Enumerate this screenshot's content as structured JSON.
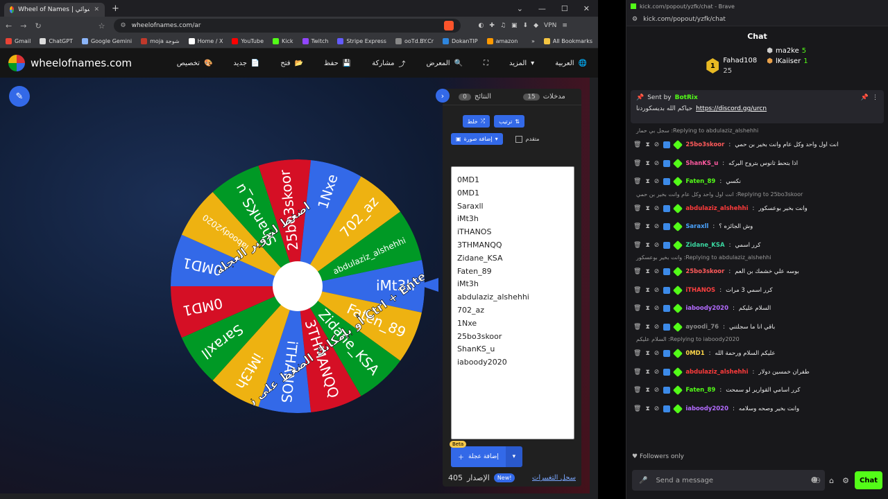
{
  "browser1": {
    "tab_title": "Wheel of Names | عجلة الاختيار العشوائي",
    "url": "wheelofnames.com/ar",
    "vpn": "VPN",
    "bookmarks": [
      {
        "label": "Gmail",
        "color": "#ea4335"
      },
      {
        "label": "ChatGPT",
        "color": "#dddddd"
      },
      {
        "label": "Google Gemini",
        "color": "#8ab4f8"
      },
      {
        "label": "moja شوجة",
        "color": "#c0392b"
      },
      {
        "label": "Home / X",
        "color": "#ffffff"
      },
      {
        "label": "YouTube",
        "color": "#ff0000"
      },
      {
        "label": "Kick",
        "color": "#53fc18"
      },
      {
        "label": "Twitch",
        "color": "#9146ff"
      },
      {
        "label": "Stripe Express",
        "color": "#635bff"
      },
      {
        "label": "ooTd.BY.Cr",
        "color": "#888888"
      },
      {
        "label": "DokanTIP",
        "color": "#2e86de"
      },
      {
        "label": "amazon",
        "color": "#ff9900"
      }
    ],
    "all_bookmarks": "All Bookmarks"
  },
  "site": {
    "logo": "wheelofnames.com",
    "menu": [
      "تخصيص",
      "جديد",
      "فتح",
      "حفظ",
      "مشاركة",
      "المعرض",
      "",
      "المزيد",
      "العربية"
    ]
  },
  "wheel": {
    "segments": [
      "iMt3h",
      "Faten_89",
      "Zidane_KSA",
      "3THMANQQ",
      "iTHANOS",
      "iMt3h",
      "Saraxll",
      "0MD1",
      "0MD1",
      "iaboody2020",
      "ShanKS_u",
      "25bo3skoor",
      "1Nxe",
      "702_az",
      "abdulaziz_alshehhi"
    ],
    "colors": [
      "#3369e8",
      "#eeb211",
      "#009925",
      "#d50f25"
    ],
    "overlay_line1": "اضغط لتدوير العجلة",
    "overlay_line2": "أو بإمكانك الضغط على زر Ctrl + Enter"
  },
  "panel": {
    "tab_entries": "مدخلات",
    "entries_count": "15",
    "tab_results": "النتائج",
    "results_count": "0",
    "shuffle": "خلط",
    "sort": "ترتيب",
    "add_image": "إضافة صورة",
    "advanced": "متقدم",
    "entries": [
      "0MD1",
      "0MD1",
      "Saraxll",
      "iMt3h",
      "iTHANOS",
      "3THMANQQ",
      "Zidane_KSA",
      "Faten_89",
      "iMt3h",
      "abdulaziz_alshehhi",
      "702_az",
      "1Nxe",
      "25bo3skoor",
      "ShanKS_u",
      "iaboody2020"
    ],
    "add_wheel": "إضافة عجلة",
    "beta": "Beta",
    "version_label": "الإصدار",
    "version": "405",
    "new": "New!",
    "changelog": "سجل التغييرات"
  },
  "browser2": {
    "title": "kick.com/popout/yzfk/chat - Brave",
    "url": "kick.com/popout/yzfk/chat"
  },
  "chat": {
    "header": "Chat",
    "leaders": [
      {
        "name": "Fahad108",
        "value": "25",
        "rank": "1"
      },
      {
        "name": "ma2ke",
        "value": "5"
      },
      {
        "name": "lKaiiser",
        "value": "1"
      }
    ],
    "pinned_by": "Sent by",
    "pinned_user": "BotRix",
    "pinned_text": "حياكم الله بديسكوردنا",
    "pinned_link": "https://discord.gg/urcn",
    "messages": [
      {
        "reply": "Replying to abdulaziz_alshehhi: سجل بي حمار",
        "user": "25bo3skoor",
        "color": "#ff5a5a",
        "text": "انت اول واحد وكل عام وانت بخير بن حمي"
      },
      {
        "reply": "",
        "user": "ShanKS_u",
        "color": "#ff5aa0",
        "text": "اذا بتحط ثانوس بتروح البركه"
      },
      {
        "reply": "",
        "user": "Faten_89",
        "color": "#53fc18",
        "text": "نكسي"
      },
      {
        "reply": "Replying to 25bo3skoor: انت اول واحد وكل عام وانت بخير بن حمي",
        "user": "abdulaziz_alshehhi",
        "color": "#ff3b3b",
        "text": "وانت بخير بوعسكور"
      },
      {
        "reply": "",
        "user": "Saraxll",
        "color": "#4aa3ff",
        "text": "وش الجائزه ؟"
      },
      {
        "reply": "",
        "user": "Zidane_KSA",
        "color": "#3ad6a0",
        "text": "كرر اسمي"
      },
      {
        "reply": "Replying to abdulaziz_alshehhi: وانت بخير بوعسكور",
        "user": "25bo3skoor",
        "color": "#ff5a5a",
        "text": "بوسه علي خشمك بن العم"
      },
      {
        "reply": "",
        "user": "iTHANOS",
        "color": "#ff4040",
        "text": "كرر اسمي 3 مرات"
      },
      {
        "reply": "",
        "user": "iaboody2020",
        "color": "#b36bff",
        "text": "السلام عليكم"
      },
      {
        "reply": "",
        "user": "ayoodi_76",
        "color": "#888888",
        "text": "باقي انا ما سجلتني"
      },
      {
        "reply": "Replying to iaboody2020: السلام عليكم",
        "user": "0MD1",
        "color": "#ffd84a",
        "text": "عليكم السلام ورحمة الله"
      },
      {
        "reply": "",
        "user": "abdulaziz_alshehhi",
        "color": "#ff3b3b",
        "text": "طفران خمسين دولار"
      },
      {
        "reply": "",
        "user": "Faten_89",
        "color": "#53fc18",
        "text": "كرر اسامي القوارير لو سمحت"
      },
      {
        "reply": "",
        "user": "iaboody2020",
        "color": "#b36bff",
        "text": "وانت بخير وصحه وسلامه"
      }
    ],
    "followers_only": "Followers only",
    "placeholder": "Send a message",
    "send": "Chat"
  }
}
